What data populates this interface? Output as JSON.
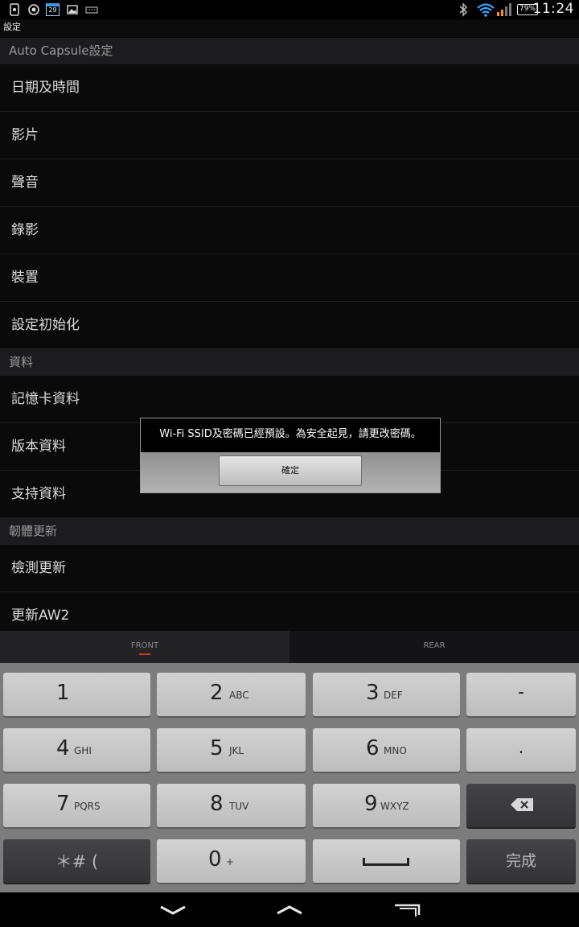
{
  "status_bar": {
    "time": "11:24",
    "battery": "79%",
    "calendar_day": "29",
    "icons": [
      "phone-icon",
      "location-target-icon",
      "calendar-icon",
      "image-icon",
      "keyboard-icon",
      "bluetooth-icon",
      "wifi-icon",
      "signal-icon",
      "battery-icon"
    ]
  },
  "app": {
    "title": "設定"
  },
  "settings": {
    "sections": [
      {
        "header": "Auto Capsule設定",
        "items": [
          "日期及時間",
          "影片",
          "聲音",
          "錄影",
          "裝置",
          "設定初始化"
        ]
      },
      {
        "header": "資料",
        "items": [
          "記憶卡資料",
          "版本資料",
          "支持資料"
        ]
      },
      {
        "header": "韌體更新",
        "items": [
          "檢測更新",
          "更新AW2"
        ]
      }
    ]
  },
  "dialog": {
    "message": "Wi-Fi SSID及密碼已經預設。為安全起見，請更改密碼。",
    "ok_label": "確定"
  },
  "camera_tabs": {
    "front": "FRONT",
    "rear": "REAR",
    "active": "front",
    "accent_color": "#c23a1e"
  },
  "keyboard": {
    "row1": [
      {
        "num": "1",
        "letters": ""
      },
      {
        "num": "2",
        "letters": "ABC"
      },
      {
        "num": "3",
        "letters": "DEF"
      },
      {
        "label": "-"
      }
    ],
    "row2": [
      {
        "num": "4",
        "letters": "GHI"
      },
      {
        "num": "5",
        "letters": "JKL"
      },
      {
        "num": "6",
        "letters": "MNO"
      },
      {
        "label": "."
      }
    ],
    "row3": [
      {
        "num": "7",
        "letters": "PQRS"
      },
      {
        "num": "8",
        "letters": "TUV"
      },
      {
        "num": "9",
        "letters": "WXYZ"
      },
      {
        "icon": "backspace-icon"
      }
    ],
    "row4": [
      {
        "label": "＊# ("
      },
      {
        "num": "0",
        "letters": "+"
      },
      {
        "icon": "space-icon"
      },
      {
        "label": "完成"
      }
    ]
  },
  "nav_bar": {
    "icons": [
      "back-icon",
      "home-icon",
      "recent-apps-icon"
    ]
  }
}
